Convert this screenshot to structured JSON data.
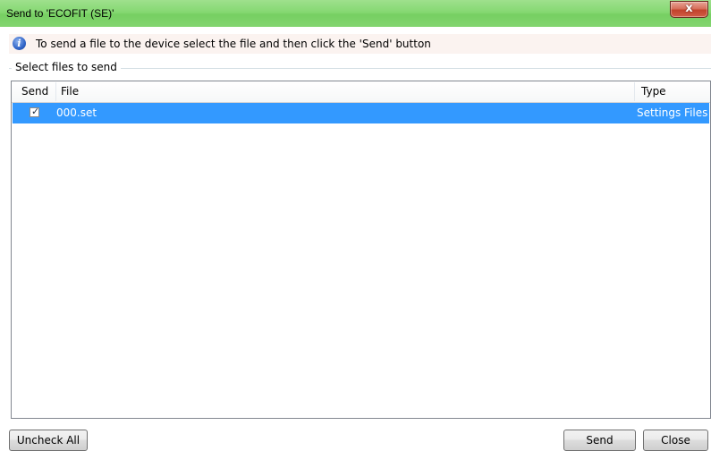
{
  "window": {
    "title": "Send to 'ECOFIT (SE)'",
    "close_glyph": "x"
  },
  "info": {
    "icon": "info-icon",
    "message": "To send a file to the device select the file and then click the 'Send' button"
  },
  "group": {
    "label": "Select files to send"
  },
  "table": {
    "columns": [
      "Send",
      "File",
      "Type"
    ],
    "rows": [
      {
        "send": true,
        "file": "000.set",
        "type": "Settings Files",
        "selected": true
      }
    ]
  },
  "buttons": {
    "uncheck_all": "Uncheck All",
    "send": "Send",
    "close": "Close"
  },
  "colors": {
    "titlebar": "#85d872",
    "selection": "#3399ff",
    "close_button": "#c2432c"
  }
}
